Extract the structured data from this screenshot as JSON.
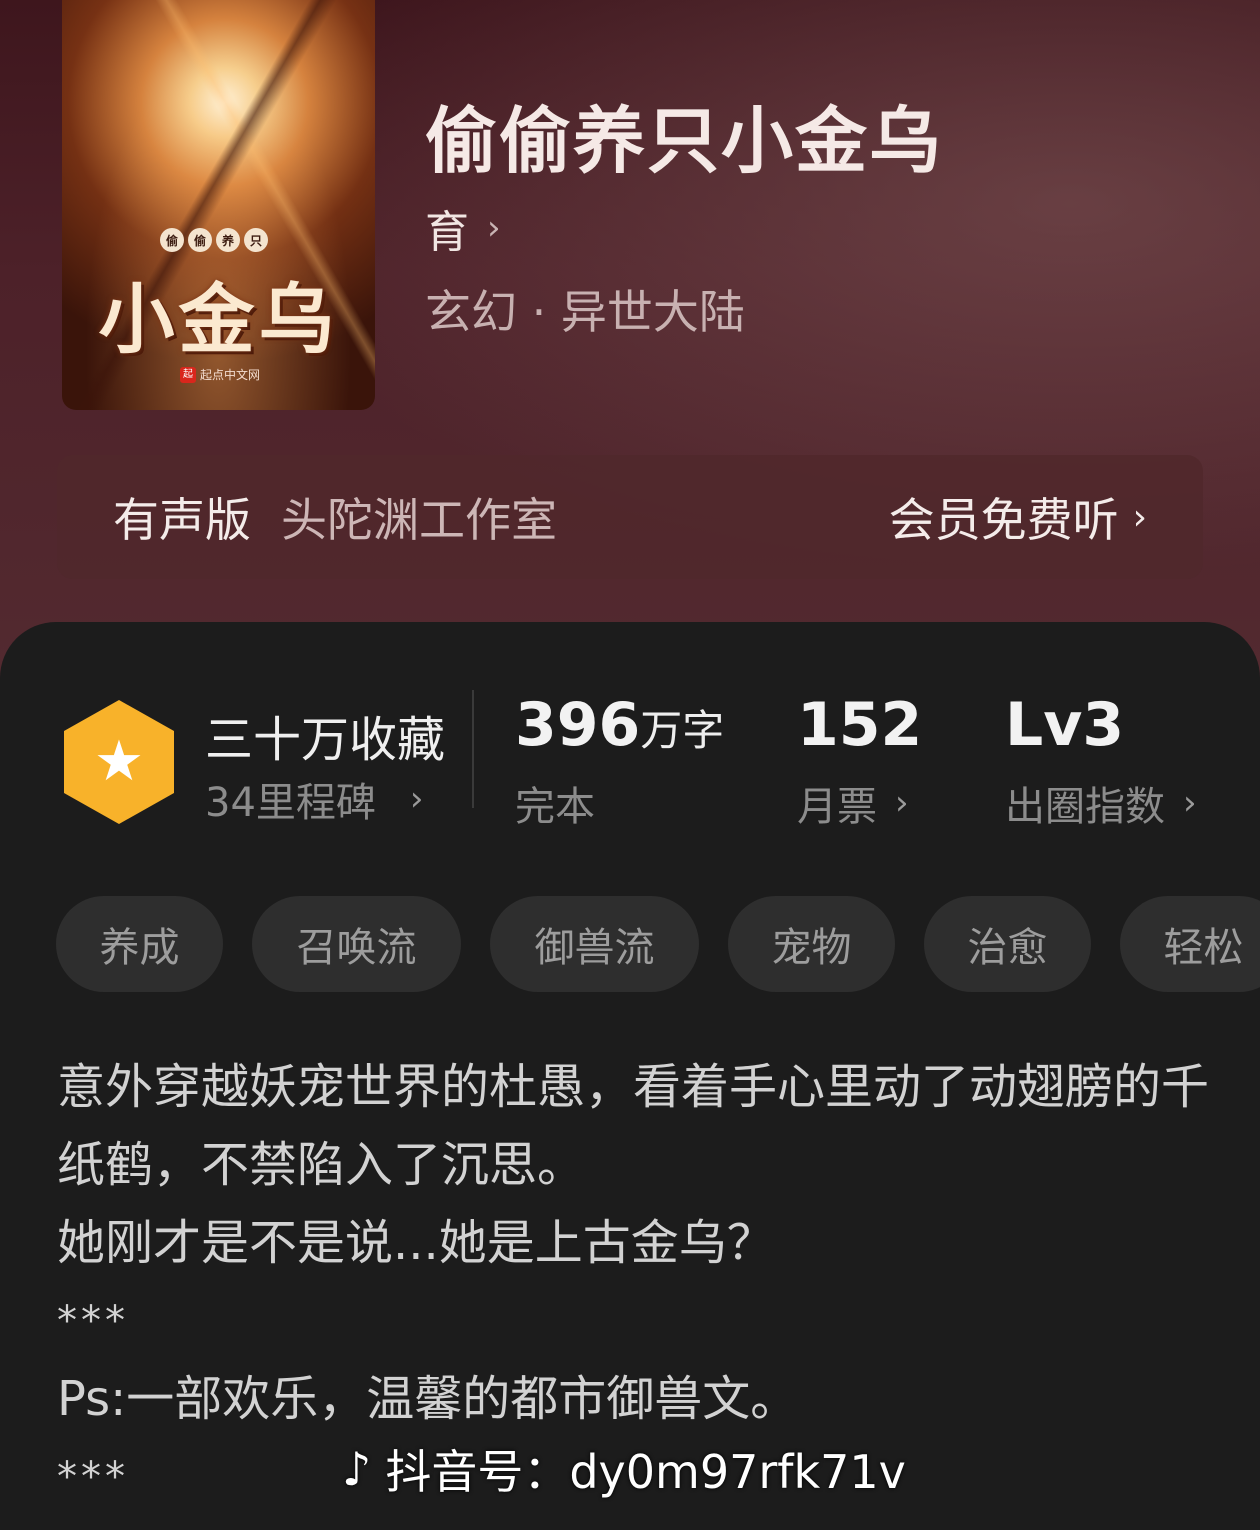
{
  "book": {
    "cover": {
      "seal_chars": [
        "偷",
        "偷",
        "养",
        "只"
      ],
      "cover_title": "小金乌",
      "publisher": "起点中文网",
      "publisher_logo": "起"
    },
    "title": "偷偷养只小金乌",
    "author": "育",
    "genre": "玄幻 · 异世大陆"
  },
  "audio": {
    "label": "有声版",
    "studio": "头陀渊工作室",
    "cta": "会员免费听"
  },
  "stats": {
    "collection": "三十万收藏",
    "milestones": "34里程碑",
    "words_value": "396",
    "words_unit": "万字",
    "status": "完本",
    "monthly_votes_value": "152",
    "monthly_votes_label": "月票",
    "level_value": "Lv3",
    "level_label": "出圈指数"
  },
  "tags": [
    "养成",
    "召唤流",
    "御兽流",
    "宠物",
    "治愈",
    "轻松"
  ],
  "description": {
    "line1": "意外穿越妖宠世界的杜愚，看着手心里动了动翅膀的千纸鹤，不禁陷入了沉思。",
    "line2": "她刚才是不是说...她是上古金乌？",
    "sep1": "***",
    "line3": "Ps:一部欢乐，温馨的都市御兽文。",
    "sep2": "***"
  },
  "watermark": {
    "icon": "tiktok-icon",
    "text": "抖音号：dy0m97rfk71v"
  },
  "colors": {
    "accent_badge": "#f8b22a",
    "panel_bg": "#1c1c1c",
    "header_bg": "#4d2129"
  }
}
